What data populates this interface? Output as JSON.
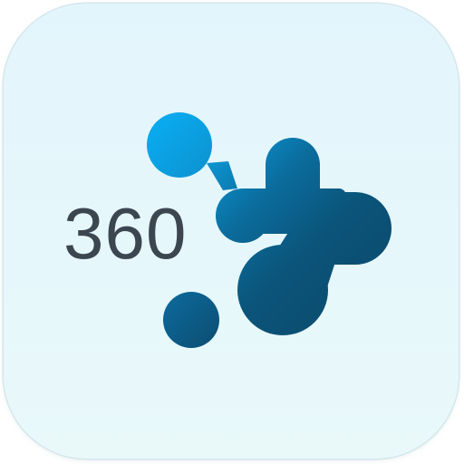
{
  "app_icon": {
    "number_text": "360",
    "colors": {
      "tile_background": "#e4f6fb",
      "dot_light_blue": "#0aa8ec",
      "dot_dark_blue": "#0b4f73",
      "text_gray": "#3c4650"
    }
  }
}
